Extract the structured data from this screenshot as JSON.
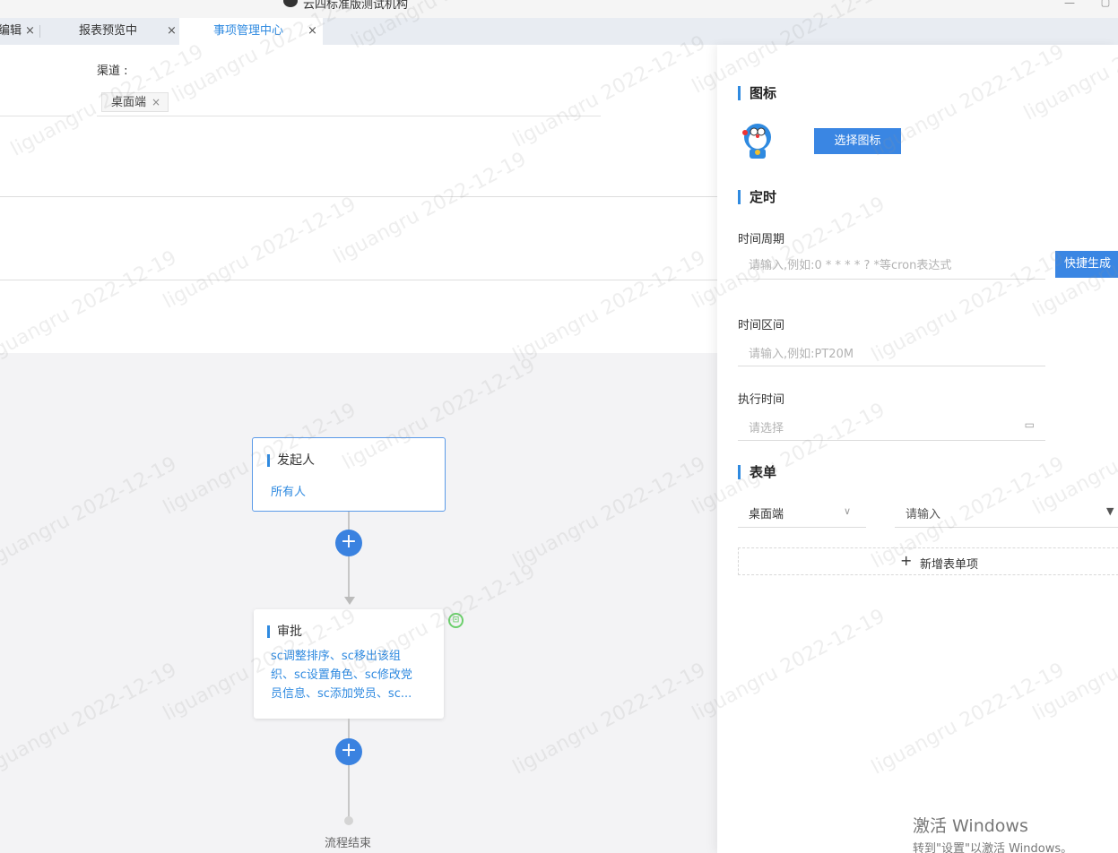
{
  "window": {
    "title": "云四标准版测试机构"
  },
  "tabs": [
    {
      "label": "编辑",
      "close": "×"
    },
    {
      "label": "报表预览中",
      "close": "×"
    },
    {
      "label": "事项管理中心",
      "close": "×"
    }
  ],
  "form": {
    "channel_label": "渠道 :",
    "channel_tag": "桌面端",
    "tag_remove": "×"
  },
  "flow": {
    "start_node": {
      "title": "发起人",
      "body": "所有人"
    },
    "approve_node": {
      "title": "审批",
      "body": "sc调整排序、sc移出该组织、sc设置角色、sc修改党员信息、sc添加党员、sc..."
    },
    "add_symbol": "+",
    "end_label": "流程结束",
    "condition_icon": "⊡"
  },
  "panel": {
    "icon_section": {
      "title": "图标",
      "choose_button": "选择图标"
    },
    "timer_section": {
      "title": "定时",
      "cycle_label": "时间周期",
      "cycle_placeholder": "请输入,例如:0 * * * * ? *等cron表达式",
      "quick_button": "快捷生成",
      "range_label": "时间区间",
      "range_placeholder": "请输入,例如:PT20M",
      "exec_label": "执行时间",
      "exec_placeholder": "请选择",
      "calendar_icon": "calendar-icon"
    },
    "form_section": {
      "title": "表单",
      "channel_value": "桌面端",
      "form_placeholder": "请输入",
      "add_symbol": "+",
      "add_label": "新增表单项"
    }
  },
  "os": {
    "activate_title": "激活 Windows",
    "activate_hint": "转到\"设置\"以激活 Windows。"
  },
  "colors": {
    "accent": "#2f8ae0",
    "button": "#3a86e3",
    "canvas": "#f3f3f5"
  }
}
